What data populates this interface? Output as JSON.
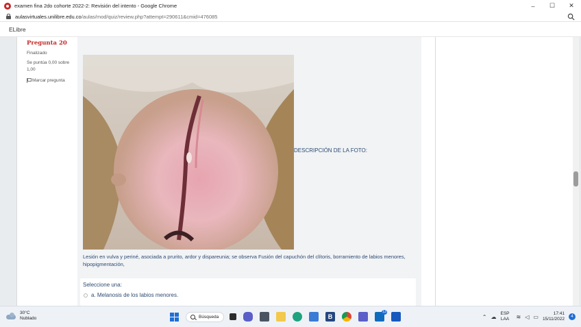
{
  "window": {
    "title": "examen fina 2do cohorte 2022-2: Revisión del intento - Google Chrome",
    "controls": [
      "–",
      "☐",
      "✕"
    ]
  },
  "address": {
    "host": "aulasvirtuales.unilibre.edu.co",
    "path": "/aulas/mod/quiz/review.php?attempt=290611&cmid=476085"
  },
  "site": {
    "brand": "ELibre"
  },
  "question": {
    "title": "Pregunta 20",
    "state": "Finalizado",
    "grade": "Se puntúa 0,00 sobre 1,00",
    "flag_label": "Marcar pregunta",
    "photo_caption": "DESCRIPCIÓN DE LA FOTO:",
    "description": "Lesión en vulva y periné, asociada a prurito, ardor y dispareunia; se observa Fusión del capuchón del clítoris, borramiento de labios menores, hipopigmentación,",
    "answer_prompt": "Seleccione una:",
    "options": [
      {
        "label": "a. Melanosis de los labios menores."
      }
    ]
  },
  "taskbar": {
    "weather_temp": "30°C",
    "weather_desc": "Nublado",
    "search_label": "Búsqueda",
    "app_icons": [
      "file-explorer-icon",
      "chat-icon",
      "calculator-icon",
      "folder-icon",
      "edge-icon",
      "store-icon",
      "app-b-icon",
      "chrome-icon",
      "teams-icon",
      "mail-icon",
      "word-icon"
    ],
    "mail_badge": "13",
    "lang_top": "ESP",
    "lang_bottom": "LAA",
    "time": "17:41",
    "date": "15/11/2022",
    "notifications": "4",
    "accent_color": "#1f6fd6"
  }
}
